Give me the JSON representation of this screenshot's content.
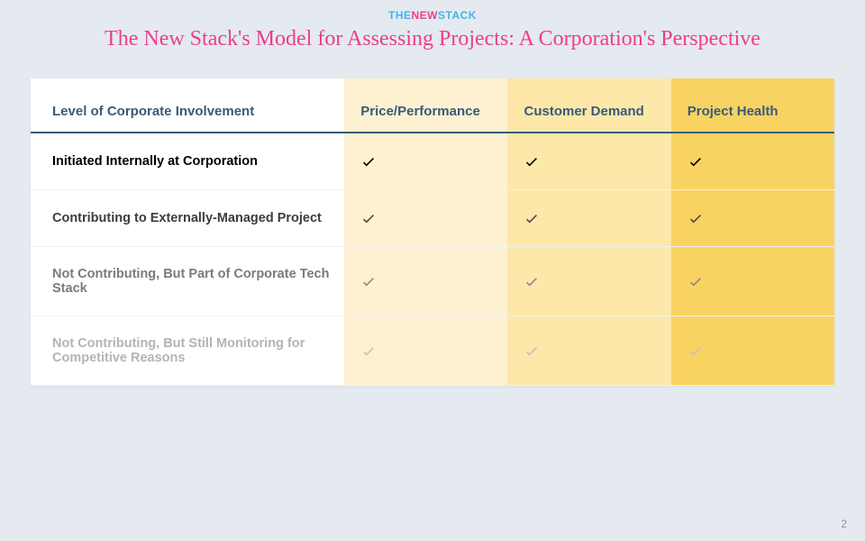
{
  "logo": {
    "part1": "THE",
    "part2": "NEW",
    "part3": "STACK"
  },
  "title": "The New Stack's Model for Assessing Projects: A Corporation's Perspective",
  "headers": {
    "col0": "Level of Corporate Involvement",
    "col1": "Price/Performance",
    "col2": "Customer Demand",
    "col3": "Project Health"
  },
  "chart_data": {
    "type": "table",
    "columns": [
      "Level of Corporate Involvement",
      "Price/Performance",
      "Customer Demand",
      "Project Health"
    ],
    "rows": [
      {
        "label": "Initiated Internally at Corporation",
        "values": [
          true,
          true,
          true
        ],
        "emphasis": 1.0
      },
      {
        "label": "Contributing to Externally-Managed Project",
        "values": [
          true,
          true,
          true
        ],
        "emphasis": 0.75
      },
      {
        "label": "Not Contributing, But Part of Corporate Tech Stack",
        "values": [
          true,
          true,
          true
        ],
        "emphasis": 0.5
      },
      {
        "label": "Not Contributing, But Still Monitoring for Competitive Reasons",
        "values": [
          true,
          true,
          true
        ],
        "emphasis": 0.3
      }
    ]
  },
  "page_number": "2"
}
